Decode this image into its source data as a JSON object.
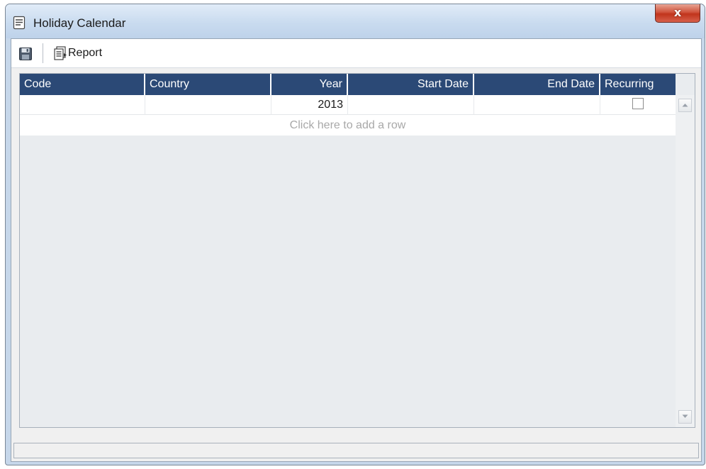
{
  "window": {
    "title": "Holiday Calendar",
    "close_glyph": "x",
    "title_icon": "calendar-document-icon"
  },
  "toolbar": {
    "save_icon": "floppy-disk-icon",
    "report_label": "Report",
    "report_icon": "report-document-icon"
  },
  "grid": {
    "columns": [
      "Code",
      "Country",
      "Year",
      "Start Date",
      "End Date",
      "Recurring"
    ],
    "rows": [
      {
        "code": "",
        "country": "",
        "year": "2013",
        "start_date": "",
        "end_date": "",
        "recurring": false
      }
    ],
    "add_row_text": "Click here to add a row"
  },
  "colors": {
    "header_bg": "#2b4976",
    "close_red": "#c0341c",
    "window_frame": "#c6d7ea"
  }
}
